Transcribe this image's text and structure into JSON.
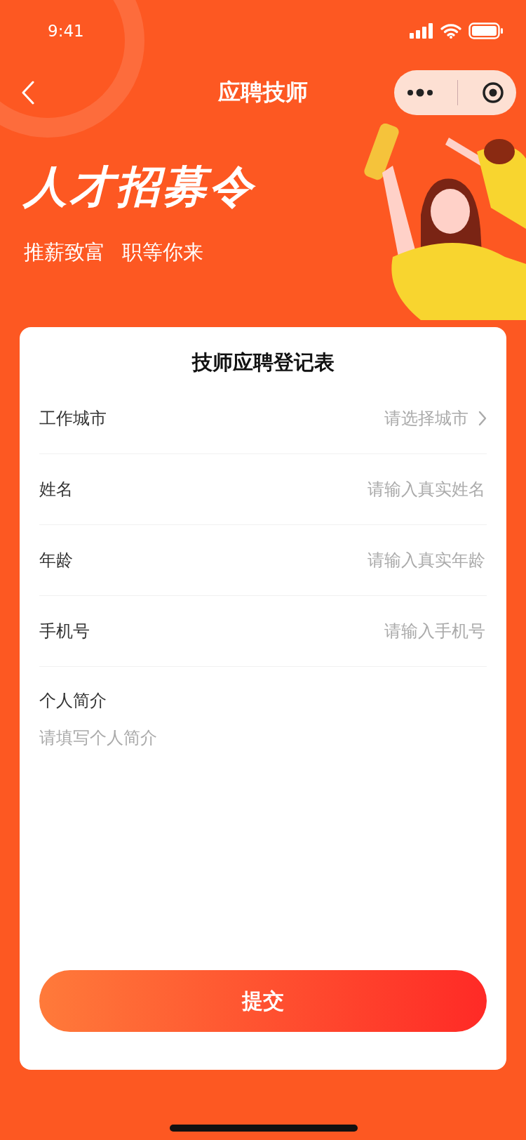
{
  "status_bar": {
    "time": "9:41"
  },
  "nav": {
    "title": "应聘技师"
  },
  "hero": {
    "title": "人才招募令",
    "subtitle": [
      "推薪致富",
      "职等你来"
    ]
  },
  "form": {
    "title": "技师应聘登记表",
    "fields": [
      {
        "kind": "select",
        "label": "工作城市",
        "placeholder": "请选择城市"
      },
      {
        "kind": "input",
        "label": "姓名",
        "placeholder": "请输入真实姓名"
      },
      {
        "kind": "input",
        "label": "年龄",
        "placeholder": "请输入真实年龄"
      },
      {
        "kind": "input",
        "label": "手机号",
        "placeholder": "请输入手机号"
      }
    ],
    "intro": {
      "label": "个人简介",
      "placeholder": "请填写个人简介"
    },
    "submit": "提交"
  }
}
